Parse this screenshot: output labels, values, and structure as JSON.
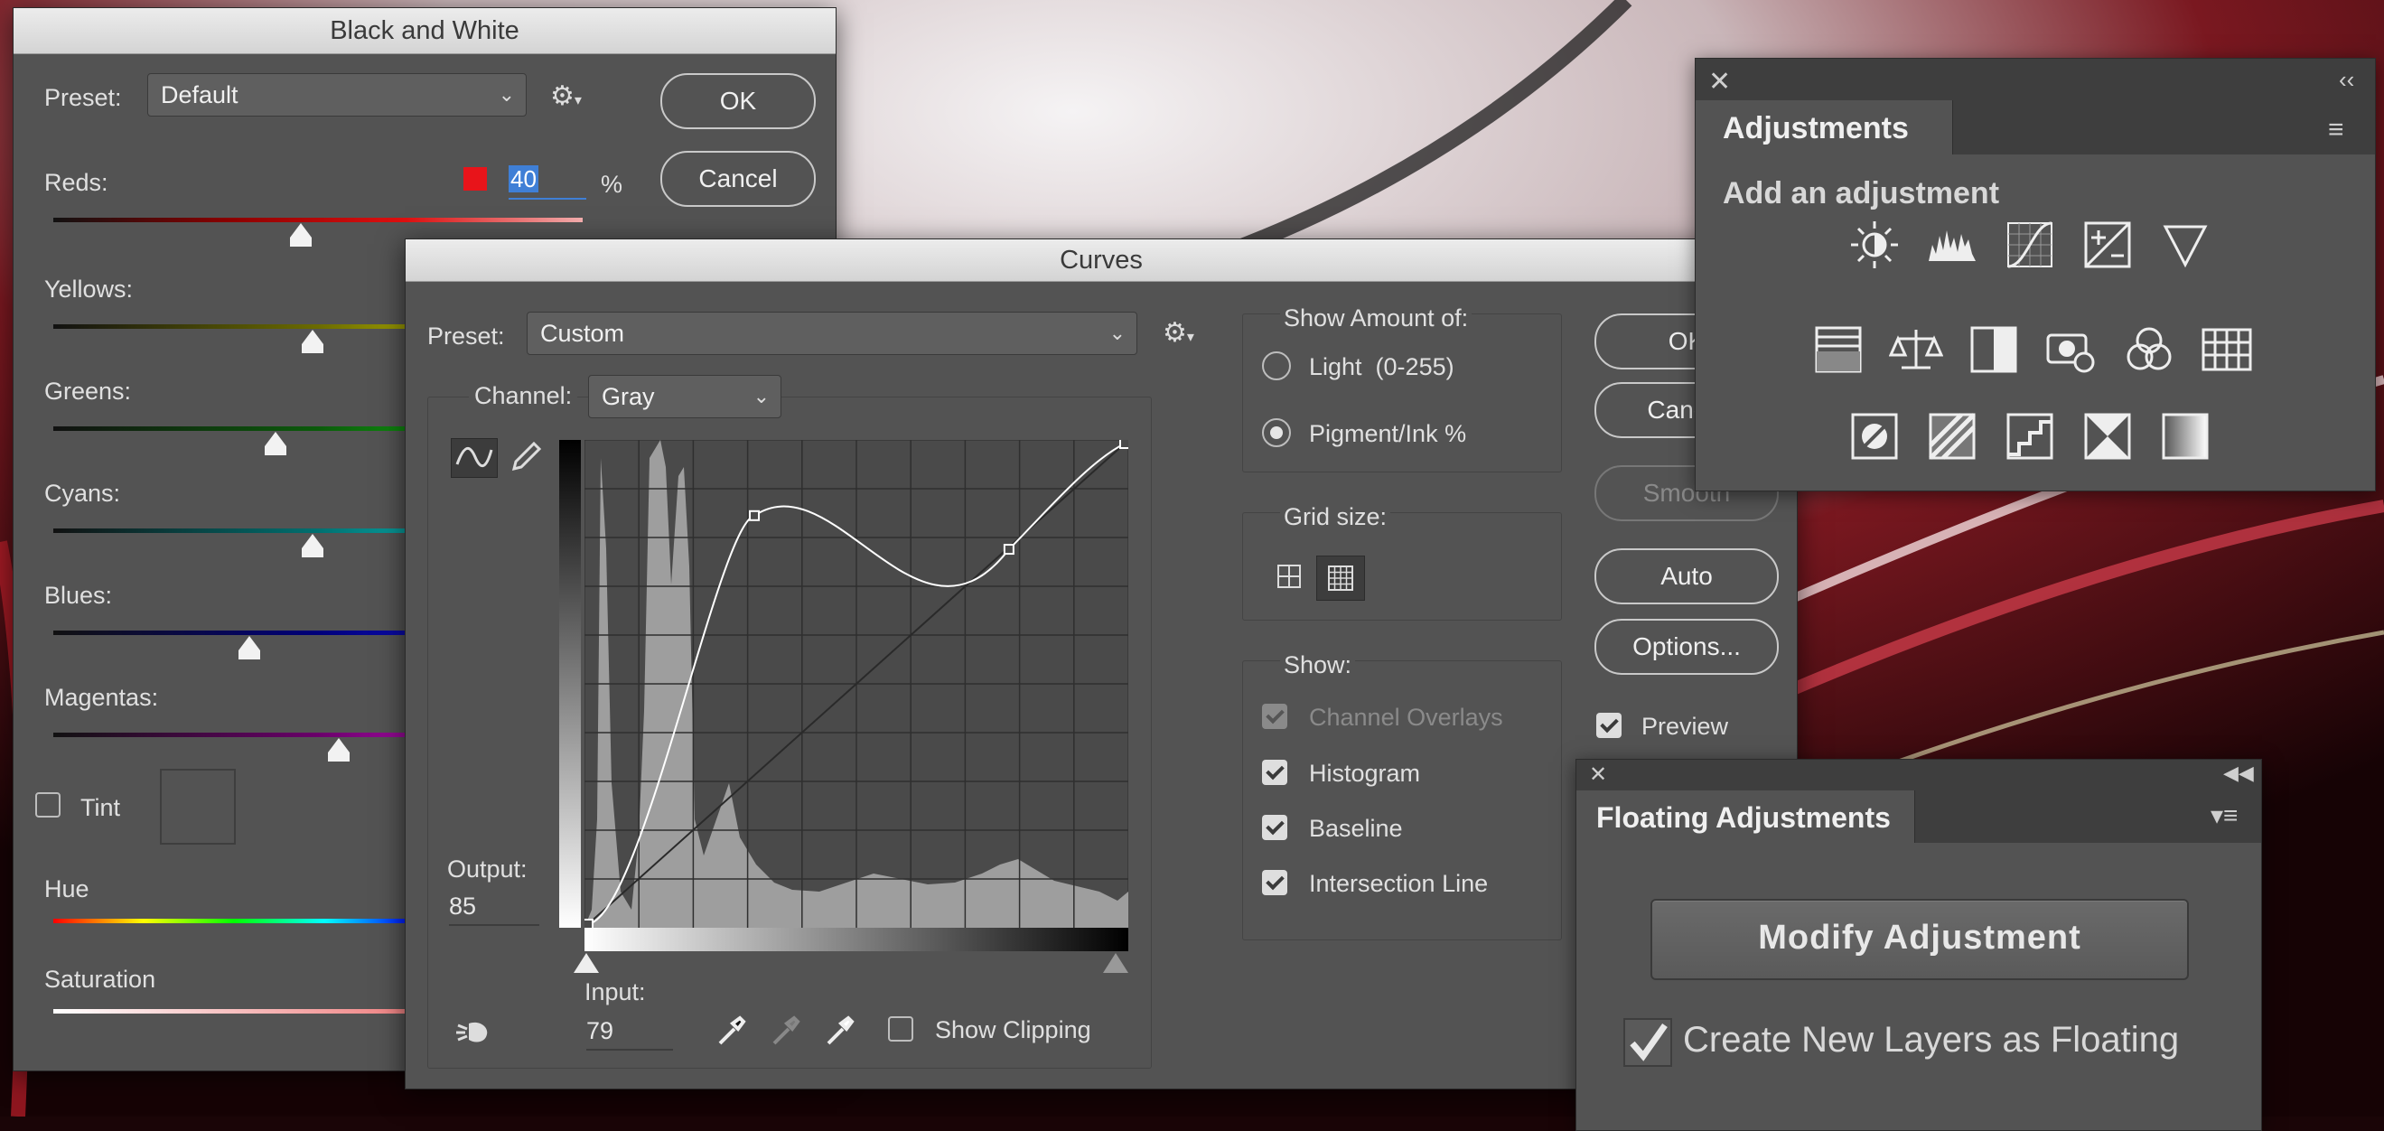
{
  "bw_dialog": {
    "title": "Black and White",
    "preset_label": "Preset:",
    "preset_value": "Default",
    "ok": "OK",
    "cancel": "Cancel",
    "reds_label": "Reds:",
    "reds_value": "40",
    "percent": "%",
    "sliders": [
      {
        "label": "Yellows:",
        "level": 0.49
      },
      {
        "label": "Greens:",
        "level": 0.42
      },
      {
        "label": "Cyans:",
        "level": 0.49
      },
      {
        "label": "Blues:",
        "level": 0.37
      },
      {
        "label": "Magentas:",
        "level": 0.54
      }
    ],
    "reds_level": 0.47,
    "tint_label": "Tint",
    "hue_label": "Hue",
    "saturation_label": "Saturation"
  },
  "curves_dialog": {
    "title": "Curves",
    "preset_label": "Preset:",
    "preset_value": "Custom",
    "channel_label": "Channel:",
    "channel_value": "Gray",
    "output_label": "Output:",
    "output_value": "85",
    "input_label": "Input:",
    "input_value": "79",
    "show_clipping": "Show Clipping",
    "show_amount_label": "Show Amount of:",
    "light_option": "Light  (0-255)",
    "pigment_option": "Pigment/Ink %",
    "grid_size_label": "Grid size:",
    "show_label": "Show:",
    "channel_overlays": "Channel Overlays",
    "histogram": "Histogram",
    "baseline": "Baseline",
    "intersection_line": "Intersection Line",
    "ok": "OK",
    "cancel": "Cancel",
    "smooth": "Smooth",
    "auto": "Auto",
    "options": "Options...",
    "preview": "Preview",
    "curve_points": [
      [
        0,
        0
      ],
      [
        79,
        85
      ],
      [
        200,
        78
      ],
      [
        255,
        100
      ]
    ]
  },
  "adjustments_panel": {
    "title": "Adjustments",
    "subtitle": "Add an adjustment",
    "icons": [
      [
        "brightness-contrast-icon",
        "levels-icon",
        "curves-icon",
        "exposure-icon",
        "vibrance-icon"
      ],
      [
        "hue-saturation-icon",
        "color-balance-icon",
        "black-white-icon",
        "photo-filter-icon",
        "channel-mixer-icon",
        "color-lookup-icon"
      ],
      [
        "invert-icon",
        "posterize-icon",
        "threshold-icon",
        "selective-color-icon",
        "gradient-map-icon"
      ]
    ]
  },
  "floating_panel": {
    "title": "Floating Adjustments",
    "modify_button": "Modify Adjustment",
    "create_floating": "Create New Layers as Floating"
  },
  "colors": {
    "accent_blue": "#3f7fd6",
    "red_swatch": "#e8141a"
  }
}
